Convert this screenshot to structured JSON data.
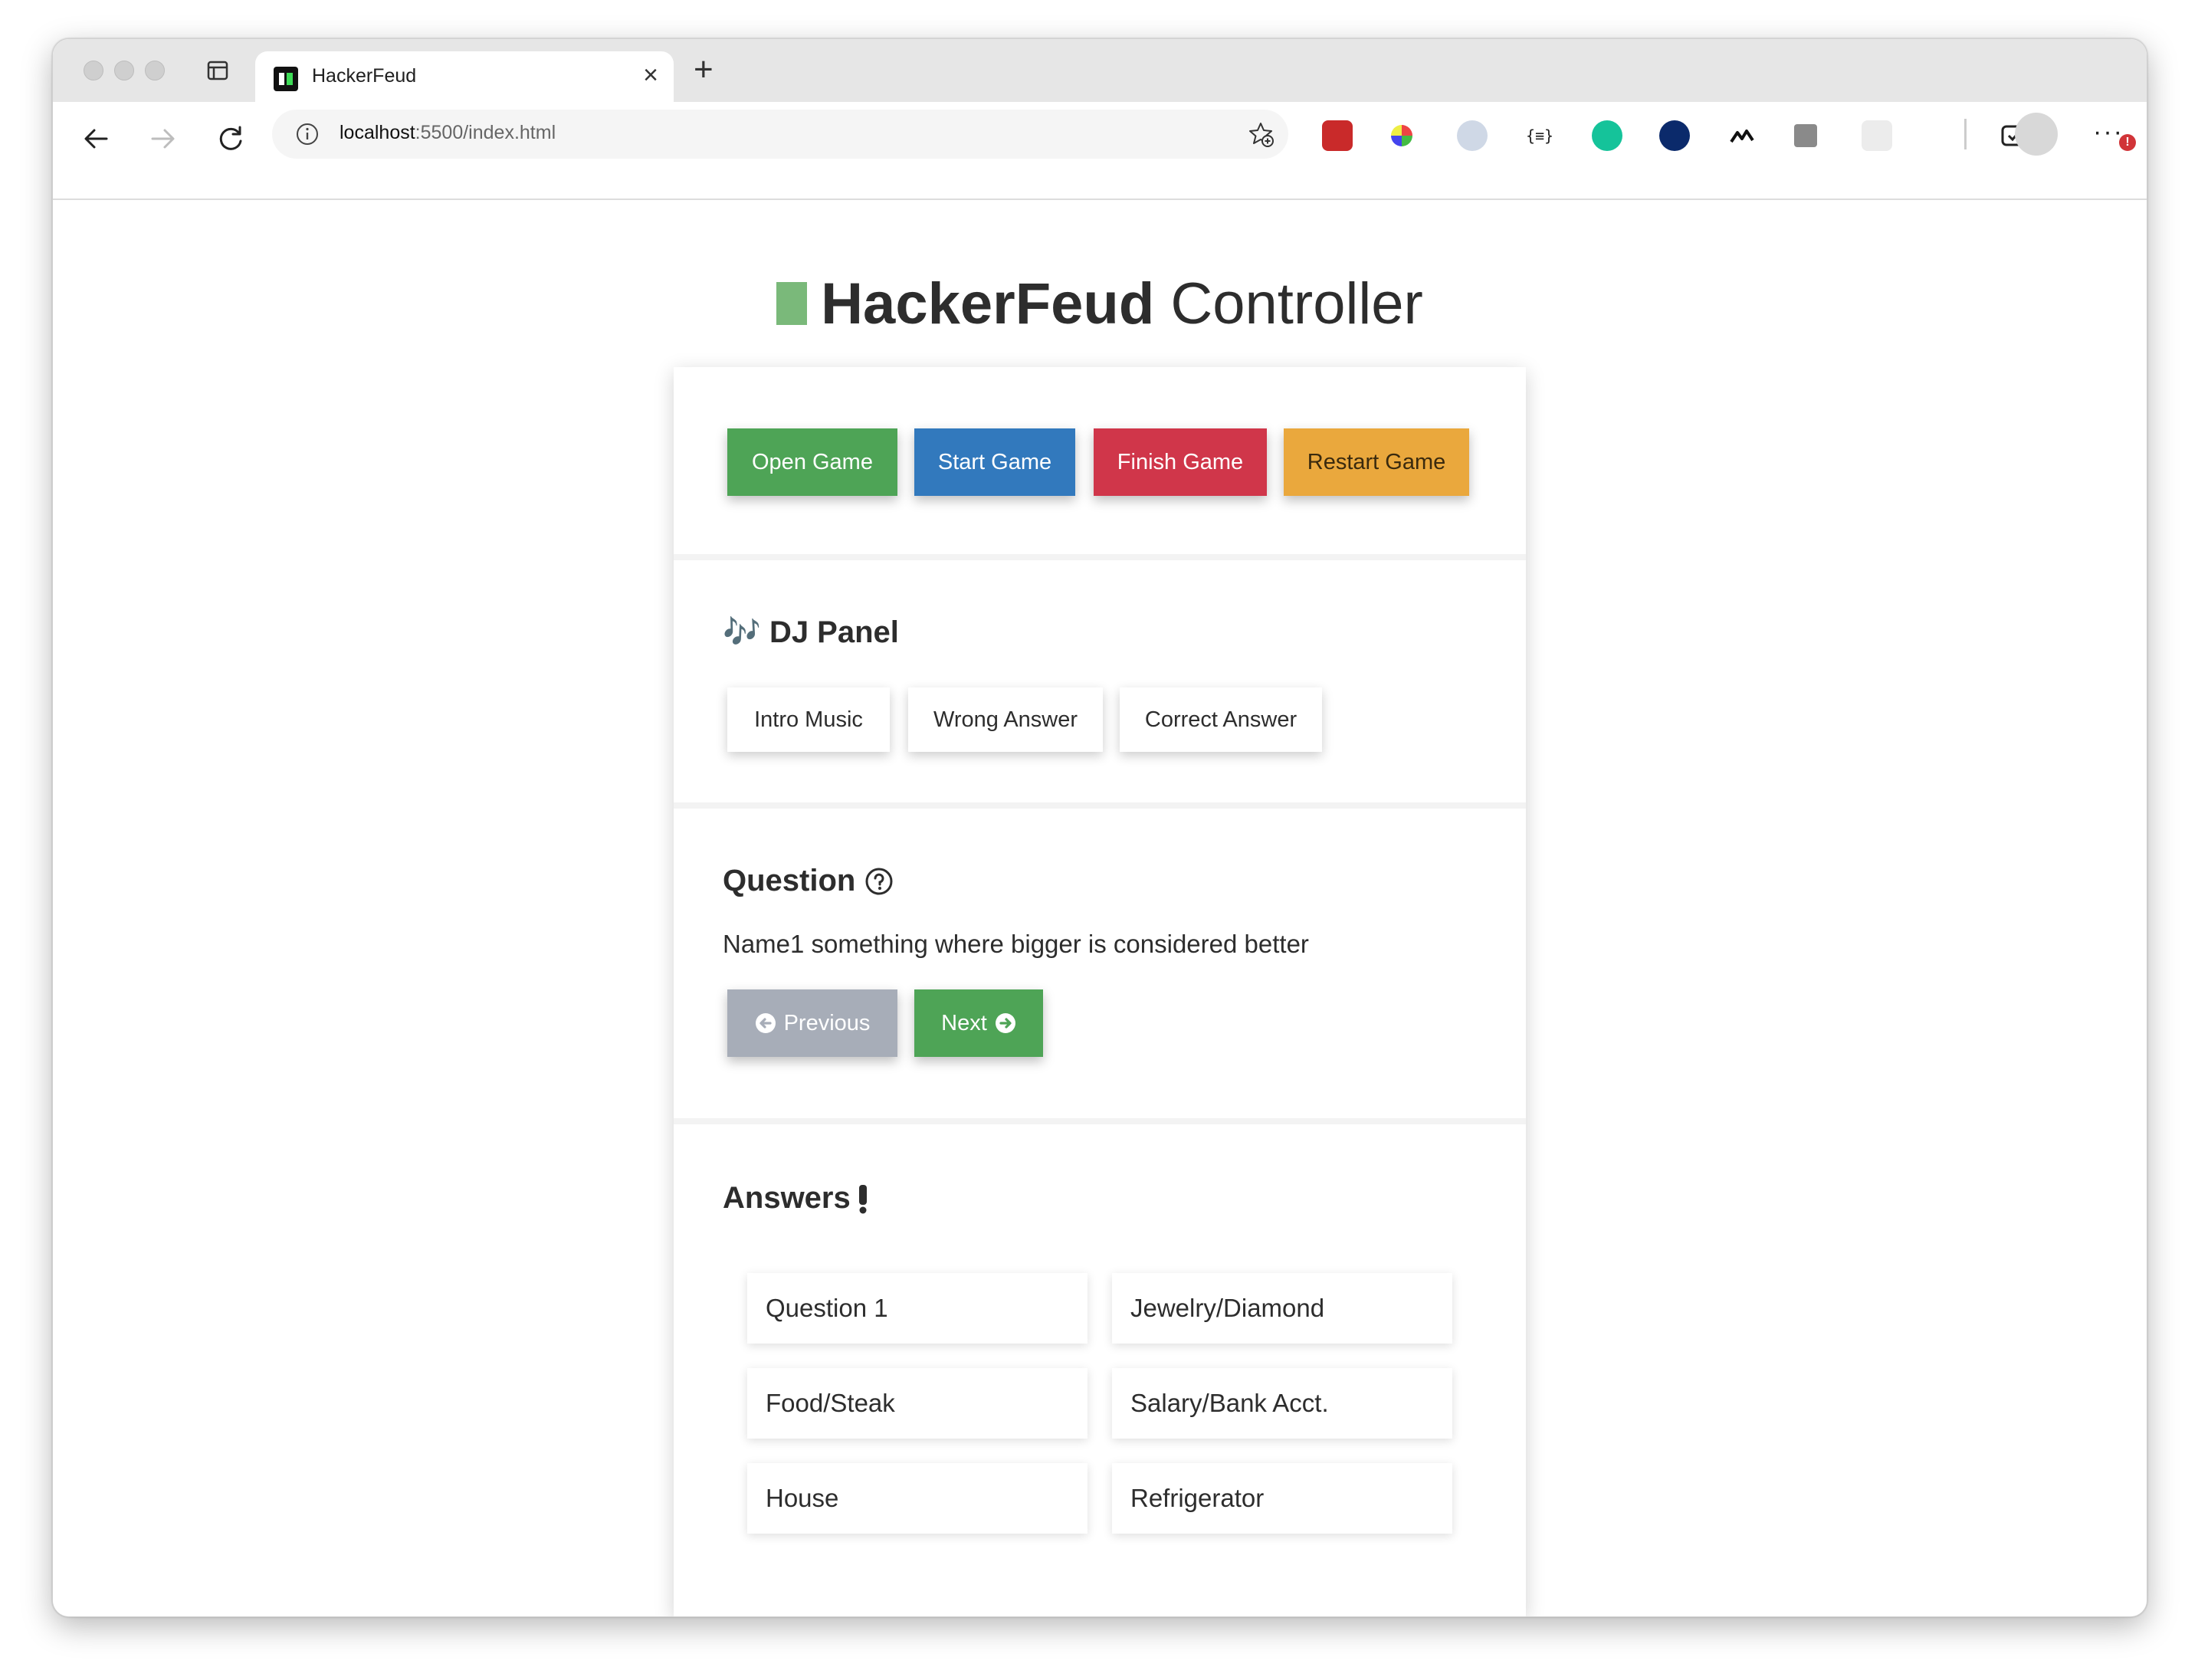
{
  "browser": {
    "tab_title": "HackerFeud",
    "tab_close": "×",
    "new_tab": "+",
    "address": {
      "host": "localhost",
      "rest": ":5500/index.html"
    },
    "more": "···",
    "more_badge": "!"
  },
  "page": {
    "title_bold": "HackerFeud",
    "title_rest": " Controller"
  },
  "controls": {
    "open_game": "Open Game",
    "start_game": "Start Game",
    "finish_game": "Finish Game",
    "restart_game": "Restart Game"
  },
  "dj_panel": {
    "icon": "🎶",
    "title": "DJ Panel",
    "intro_music": "Intro Music",
    "wrong_answer": "Wrong Answer",
    "correct_answer": "Correct Answer"
  },
  "question": {
    "title": "Question",
    "text": "Name1 something where bigger is considered better",
    "previous": "Previous",
    "next": "Next"
  },
  "answers": {
    "title": "Answers",
    "items": [
      "Question 1",
      "Jewelry/Diamond",
      "Food/Steak",
      "Salary/Bank Acct.",
      "House",
      "Refrigerator"
    ]
  },
  "colors": {
    "green": "#4ea456",
    "blue": "#3279bd",
    "red": "#d0364a",
    "orange": "#eaa83d",
    "gray": "#a7adb8",
    "title_mark": "#7ab97a"
  }
}
